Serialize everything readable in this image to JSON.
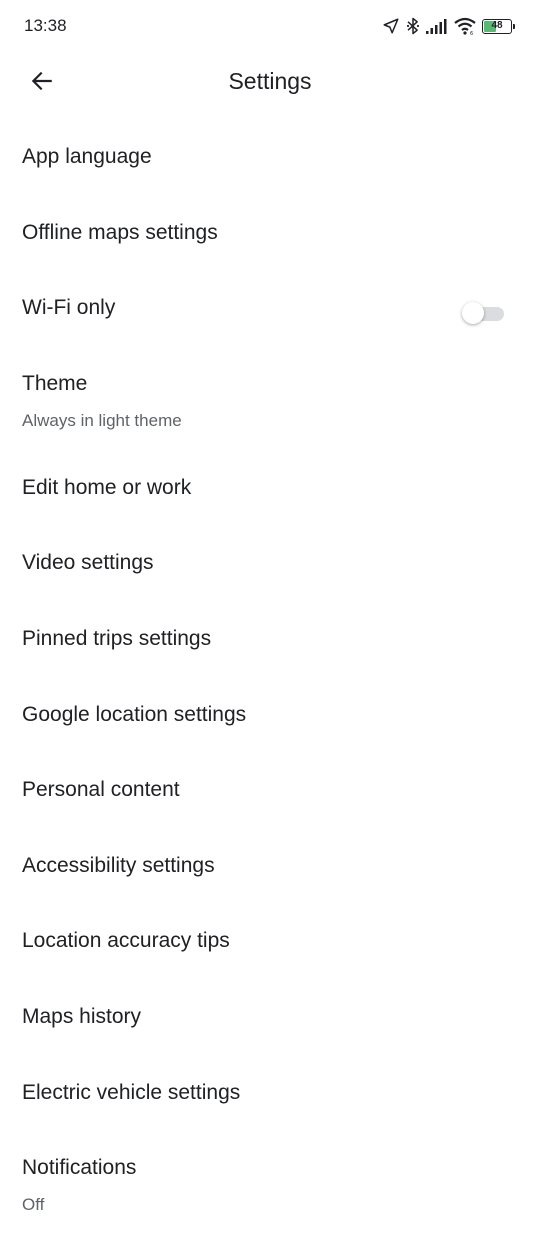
{
  "status_bar": {
    "time": "13:38",
    "battery_level": "48",
    "battery_fraction": 0.48
  },
  "header": {
    "title": "Settings",
    "back_icon": "arrow-back-icon"
  },
  "settings": {
    "items": [
      {
        "label": "App language"
      },
      {
        "label": "Offline maps settings"
      },
      {
        "label": "Wi-Fi only",
        "toggle_on": false
      },
      {
        "label": "Theme",
        "subtitle": "Always in light theme"
      },
      {
        "label": "Edit home or work"
      },
      {
        "label": "Video settings"
      },
      {
        "label": "Pinned trips settings"
      },
      {
        "label": "Google location settings"
      },
      {
        "label": "Personal content"
      },
      {
        "label": "Accessibility settings"
      },
      {
        "label": "Location accuracy tips"
      },
      {
        "label": "Maps history"
      },
      {
        "label": "Electric vehicle settings"
      },
      {
        "label": "Notifications",
        "subtitle": "Off"
      }
    ]
  },
  "colors": {
    "text_primary": "#202124",
    "text_secondary": "#5f6368",
    "toggle_track_off": "#dadce0",
    "battery_fill": "#5bb974"
  }
}
